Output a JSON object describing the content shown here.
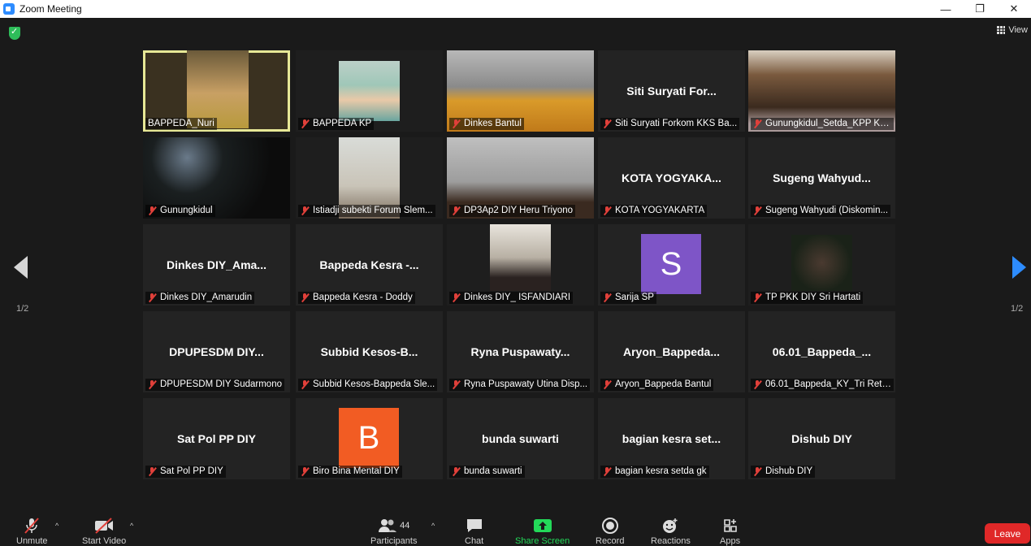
{
  "window": {
    "title": "Zoom Meeting",
    "controls": [
      "—",
      "❐",
      "✕"
    ]
  },
  "view_button": "View",
  "pager": {
    "left": "1/2",
    "right": "1/2"
  },
  "tiles": [
    {
      "name": "BAPPEDA_Nuri",
      "big": "",
      "muted": false,
      "video": true
    },
    {
      "name": "BAPPEDA KP",
      "big": "",
      "muted": true,
      "video": true
    },
    {
      "name": "Dinkes Bantul",
      "big": "",
      "muted": true,
      "video": true
    },
    {
      "name": "Siti Suryati  Forkom KKS Ba...",
      "big": "Siti Suryati  For...",
      "muted": true,
      "video": false
    },
    {
      "name": "Gunungkidul_Setda_KPP Ke...",
      "big": "",
      "muted": true,
      "video": true
    },
    {
      "name": "Gunungkidul",
      "big": "",
      "muted": true,
      "video": true
    },
    {
      "name": "Istiadji subekti Forum Slem...",
      "big": "",
      "muted": true,
      "video": true
    },
    {
      "name": "DP3Ap2 DIY Heru Triyono",
      "big": "",
      "muted": true,
      "video": true
    },
    {
      "name": "KOTA YOGYAKARTA",
      "big": "KOTA YOGYAKA...",
      "muted": true,
      "video": false
    },
    {
      "name": "Sugeng Wahyudi (Diskomin...",
      "big": "Sugeng  Wahyud...",
      "muted": true,
      "video": false
    },
    {
      "name": "Dinkes DIY_Amarudin",
      "big": "Dinkes  DIY_Ama...",
      "muted": true,
      "video": false
    },
    {
      "name": "Bappeda Kesra - Doddy",
      "big": "Bappeda Kesra  -...",
      "muted": true,
      "video": false
    },
    {
      "name": "Dinkes DIY_ ISFANDIARI",
      "big": "",
      "muted": true,
      "video": true
    },
    {
      "name": "Sarija SP",
      "big": "",
      "muted": true,
      "video": false,
      "avatar": "S",
      "avatar_color": "#7e55c7"
    },
    {
      "name": "TP PKK DIY Sri Hartati",
      "big": "",
      "muted": true,
      "video": true
    },
    {
      "name": "DPUPESDM DIY Sudarmono",
      "big": "DPUPESDM  DIY...",
      "muted": true,
      "video": false
    },
    {
      "name": "Subbid Kesos-Bappeda Sle...",
      "big": "Subbid  Kesos-B...",
      "muted": true,
      "video": false
    },
    {
      "name": "Ryna Puspawaty Utina Disp...",
      "big": "Ryna  Puspawaty...",
      "muted": true,
      "video": false
    },
    {
      "name": "Aryon_Bappeda Bantul",
      "big": "Aryon_Bappeda...",
      "muted": true,
      "video": false
    },
    {
      "name": "06.01_Bappeda_KY_Tri Retn...",
      "big": "06.01_Bappeda_...",
      "muted": true,
      "video": false
    },
    {
      "name": "Sat Pol PP DIY",
      "big": "Sat Pol PP DIY",
      "muted": true,
      "video": false
    },
    {
      "name": "Biro Bina Mental DIY",
      "big": "",
      "muted": true,
      "video": false,
      "avatar": "B",
      "avatar_color": "#f25c23"
    },
    {
      "name": "bunda suwarti",
      "big": "bunda suwarti",
      "muted": true,
      "video": false
    },
    {
      "name": "bagian kesra setda gk",
      "big": "bagian kesra set...",
      "muted": true,
      "video": false
    },
    {
      "name": "Dishub DIY",
      "big": "Dishub DIY",
      "muted": true,
      "video": false
    }
  ],
  "toolbar": {
    "unmute": "Unmute",
    "start_video": "Start Video",
    "participants": "Participants",
    "participant_count": "44",
    "chat": "Chat",
    "share_screen": "Share Screen",
    "record": "Record",
    "reactions": "Reactions",
    "apps": "Apps",
    "leave": "Leave"
  }
}
